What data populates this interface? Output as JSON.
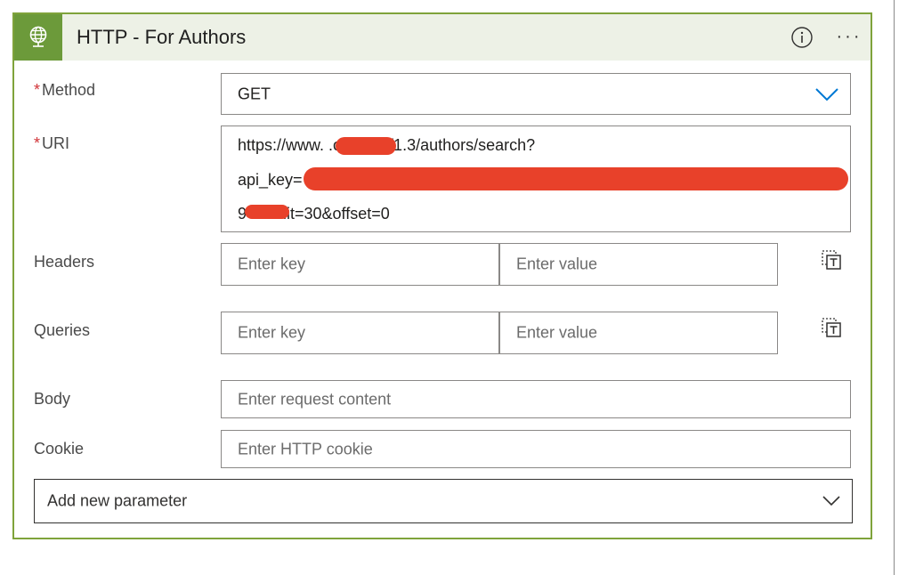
{
  "card": {
    "title": "HTTP - For Authors",
    "accent_color": "#6c9a3a",
    "border_color": "#7fa33b",
    "header_icon": "globe-icon",
    "info_icon": "info-icon",
    "more_label": "···"
  },
  "fields": {
    "method": {
      "required_mark": "*",
      "label": "Method",
      "value": "GET"
    },
    "uri": {
      "required_mark": "*",
      "label": "URI",
      "lines": [
        "https://www.           .com/api/1.3/authors/search?",
        "api_key=",
        "9     I&limit=30&offset=0"
      ]
    },
    "headers": {
      "label": "Headers",
      "key_placeholder": "Enter key",
      "value_placeholder": "Enter value"
    },
    "queries": {
      "label": "Queries",
      "key_placeholder": "Enter key",
      "value_placeholder": "Enter value"
    },
    "body": {
      "label": "Body",
      "placeholder": "Enter request content"
    },
    "cookie": {
      "label": "Cookie",
      "placeholder": "Enter HTTP cookie"
    }
  },
  "add_parameter": {
    "label": "Add new parameter"
  },
  "colors": {
    "required": "#d13438",
    "redaction": "#e8412a",
    "chevron_blue": "#0078d4"
  }
}
